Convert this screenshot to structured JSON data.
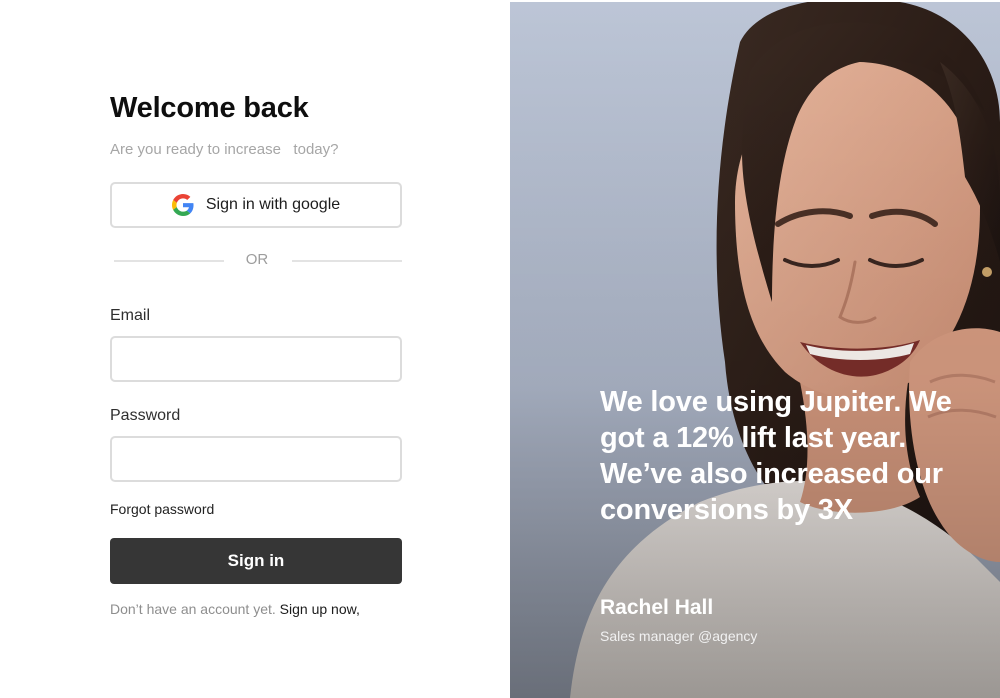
{
  "login": {
    "title": "Welcome back",
    "subtitle": "Are you ready to increase   today?",
    "google_button_label": "Sign in with google",
    "divider_text": "OR",
    "email_label": "Email",
    "email_value": "",
    "password_label": "Password",
    "password_value": "",
    "forgot_password": "Forgot password",
    "signin_button": "Sign in",
    "no_account_text": "Don’t have an account yet.",
    "signup_link": "Sign up now,"
  },
  "testimonial": {
    "quote": "We love using Jupiter. We got a 12% lift last year. We’ve also increased our conversions by 3X",
    "author_name": "Rachel Hall",
    "author_role": "Sales manager @agency",
    "photo_subject": "smiling-woman-photo"
  },
  "icons": {
    "google": "google-icon"
  },
  "colors": {
    "primary_button": "#363636",
    "border": "#dcdcdc",
    "muted_text": "#a6a6a6",
    "photo_background": "#b9c2d3",
    "google_blue": "#4285F4",
    "google_red": "#EA4335",
    "google_yellow": "#FBBC05",
    "google_green": "#34A853"
  }
}
